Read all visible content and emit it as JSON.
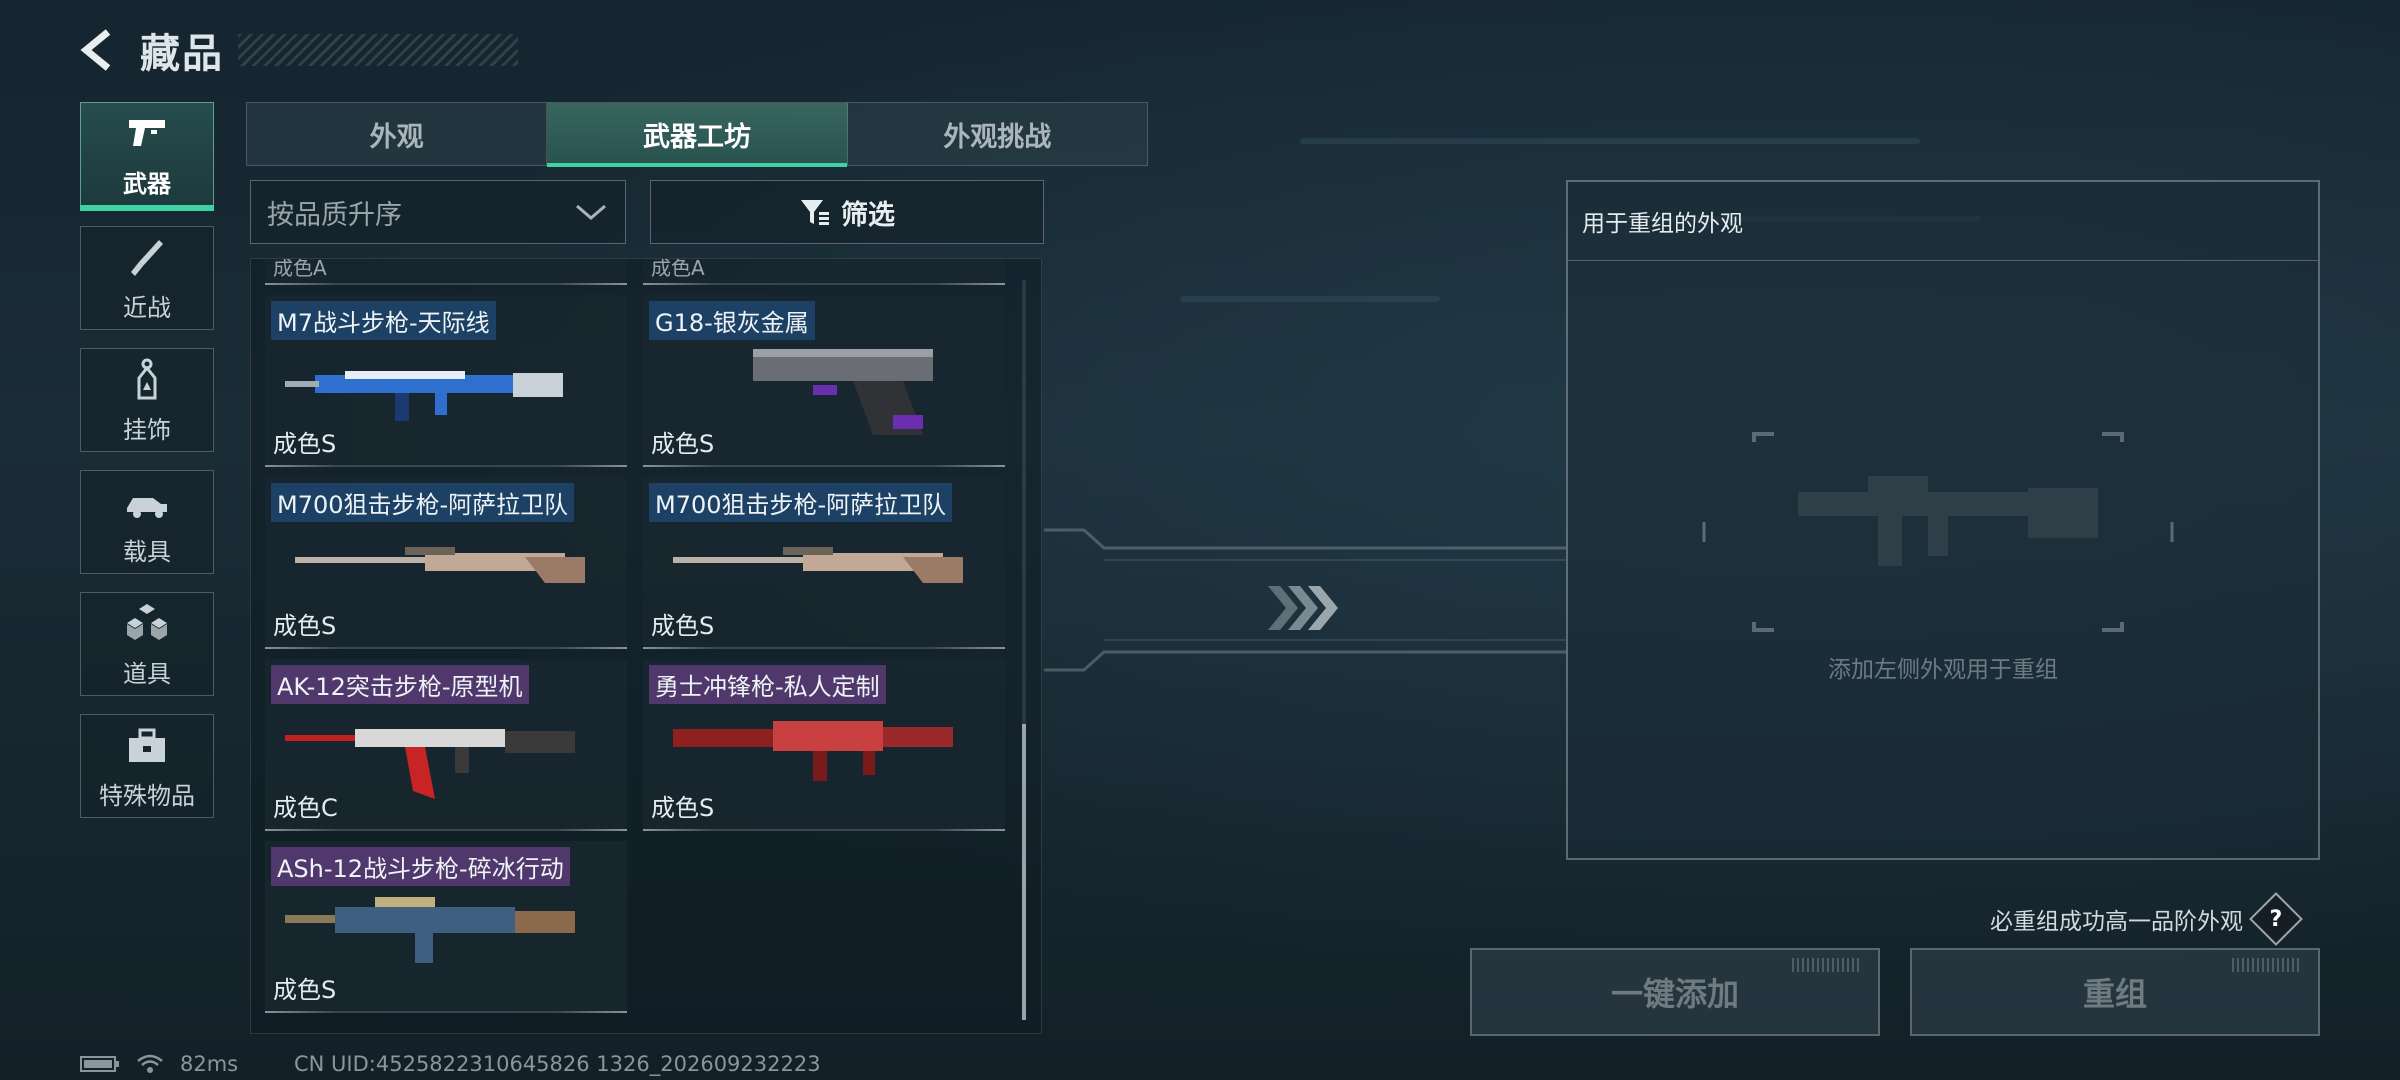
{
  "header": {
    "title": "藏品",
    "back_icon": "back-arrow-icon"
  },
  "categories": [
    {
      "label": "武器",
      "icon": "pistol-icon",
      "active": true
    },
    {
      "label": "近战",
      "icon": "knife-icon",
      "active": false
    },
    {
      "label": "挂饰",
      "icon": "charm-tag-icon",
      "active": false
    },
    {
      "label": "载具",
      "icon": "vehicle-icon",
      "active": false
    },
    {
      "label": "道具",
      "icon": "cubes-icon",
      "active": false
    },
    {
      "label": "特殊物品",
      "icon": "toolbox-icon",
      "active": false
    }
  ],
  "tabs": [
    {
      "label": "外观",
      "active": false
    },
    {
      "label": "武器工坊",
      "active": true
    },
    {
      "label": "外观挑战",
      "active": false
    }
  ],
  "sort": {
    "value": "按品质升序"
  },
  "filter": {
    "label": "筛选"
  },
  "items": {
    "partial_top": [
      {
        "grade": "成色A"
      },
      {
        "grade": "成色A"
      }
    ],
    "cards": [
      {
        "name": "M7战斗步枪-天际线",
        "grade": "成色S",
        "tag_color": "blue"
      },
      {
        "name": "G18-银灰金属",
        "grade": "成色S",
        "tag_color": "blue"
      },
      {
        "name": "M700狙击步枪-阿萨拉卫队",
        "grade": "成色S",
        "tag_color": "blue"
      },
      {
        "name": "M700狙击步枪-阿萨拉卫队",
        "grade": "成色S",
        "tag_color": "blue"
      },
      {
        "name": "AK-12突击步枪-原型机",
        "grade": "成色C",
        "tag_color": "purple"
      },
      {
        "name": "勇士冲锋枪-私人定制",
        "grade": "成色S",
        "tag_color": "purple"
      },
      {
        "name": "ASh-12战斗步枪-碎冰行动",
        "grade": "成色S",
        "tag_color": "purple"
      }
    ]
  },
  "panel": {
    "title": "用于重组的外观",
    "hint": "添加左侧外观用于重组"
  },
  "note": {
    "text": "必重组成功高一品阶外观",
    "help": "?"
  },
  "buttons": {
    "add_all": "一键添加",
    "recombine": "重组"
  },
  "status": {
    "ping": "82ms",
    "uid": "CN UID:4525822310645826 1326_202609232223"
  },
  "colors": {
    "accent": "#3fd3a4",
    "tag_blue": "#1e466e",
    "tag_purple": "#5a3c78"
  }
}
